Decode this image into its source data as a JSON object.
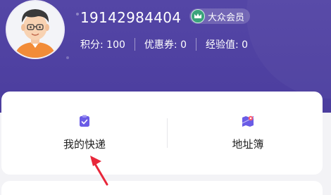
{
  "user": {
    "phone": "19142984404",
    "member_level": "大众会员",
    "stats": [
      {
        "label": "积分:",
        "value": "100"
      },
      {
        "label": "优惠券:",
        "value": "0"
      },
      {
        "label": "经验值:",
        "value": "0"
      }
    ]
  },
  "menu": {
    "my_express": "我的快递",
    "address_book": "地址簿"
  },
  "colors": {
    "header": "#5446a6",
    "accent": "#6a5ce6",
    "badge_green": "#3aa37b",
    "arrow_red": "#e8273a"
  },
  "icons": {
    "avatar": "user-avatar",
    "member": "crown-icon",
    "my_express": "clipboard-check-icon",
    "address_book": "map-pin-icon"
  }
}
